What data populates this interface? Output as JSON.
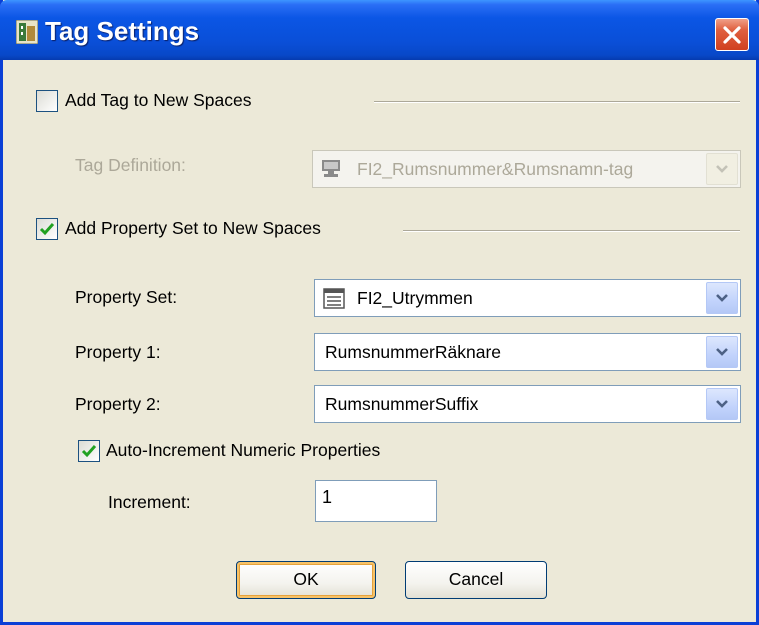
{
  "dialog": {
    "title": "Tag Settings",
    "icons": {
      "app": "app-building-icon",
      "close": "close-x-icon"
    }
  },
  "tag_section": {
    "checkbox_label": "Add Tag to New Spaces",
    "checked": false,
    "definition_label": "Tag Definition:",
    "definition_value": "FI2_Rumsnummer&Rumsnamn-tag",
    "enabled": false
  },
  "property_section": {
    "checkbox_label": "Add Property Set to New Spaces",
    "checked": true,
    "property_set_label": "Property Set:",
    "property_set_value": "FI2_Utrymmen",
    "property1_label": "Property 1:",
    "property1_value": "RumsnummerRäknare",
    "property2_label": "Property 2:",
    "property2_value": "RumsnummerSuffix",
    "auto_increment_label": "Auto-Increment Numeric Properties",
    "auto_increment_checked": true,
    "increment_label": "Increment:",
    "increment_value": "1"
  },
  "buttons": {
    "ok": "OK",
    "cancel": "Cancel"
  },
  "colors": {
    "titlebar": "#0a4fd8",
    "dialog_bg": "#ece9d8",
    "check": "#21a121",
    "disabled_text": "#aca899"
  }
}
